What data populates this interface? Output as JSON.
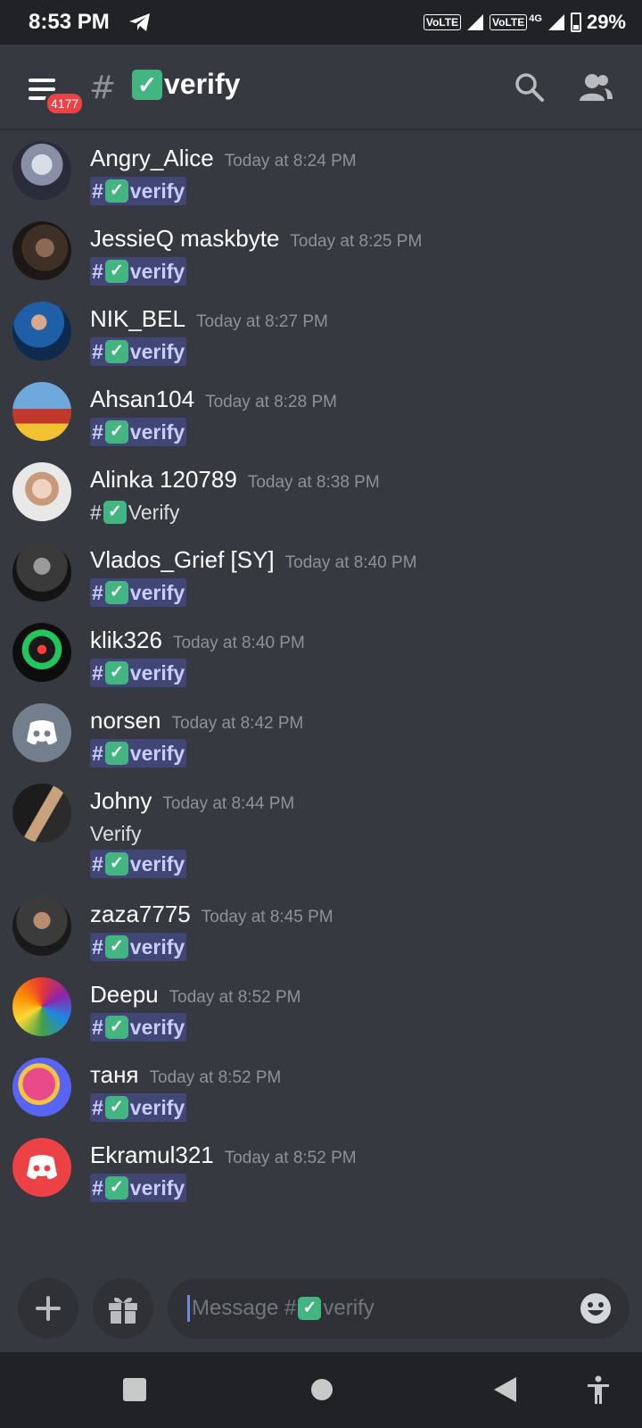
{
  "status_bar": {
    "time": "8:53 PM",
    "volte1": "VoLTE",
    "volte2": "VoLTE",
    "network": "4G",
    "battery": "29%"
  },
  "header": {
    "badge": "4177",
    "hash": "#",
    "channel_name": "verify"
  },
  "messages": [
    {
      "username": "Angry_Alice",
      "timestamp": "Today at 8:24 PM",
      "lines": [
        {
          "type": "mention",
          "text": "verify"
        }
      ]
    },
    {
      "username": "JessieQ maskbyte",
      "timestamp": "Today at 8:25 PM",
      "lines": [
        {
          "type": "mention",
          "text": "verify"
        }
      ]
    },
    {
      "username": "NIK_BEL",
      "timestamp": "Today at 8:27 PM",
      "lines": [
        {
          "type": "mention",
          "text": "verify"
        }
      ]
    },
    {
      "username": "Ahsan104",
      "timestamp": "Today at 8:28 PM",
      "lines": [
        {
          "type": "mention",
          "text": "verify"
        }
      ]
    },
    {
      "username": "Alinka 120789",
      "timestamp": "Today at 8:38 PM",
      "lines": [
        {
          "type": "plain_check",
          "text": "Verify"
        }
      ]
    },
    {
      "username": "Vlados_Grief [SY]",
      "timestamp": "Today at 8:40 PM",
      "lines": [
        {
          "type": "mention",
          "text": "verify"
        }
      ]
    },
    {
      "username": "klik326",
      "timestamp": "Today at 8:40 PM",
      "lines": [
        {
          "type": "mention",
          "text": "verify"
        }
      ]
    },
    {
      "username": "norsen",
      "timestamp": "Today at 8:42 PM",
      "lines": [
        {
          "type": "mention",
          "text": "verify"
        }
      ]
    },
    {
      "username": "Johny",
      "timestamp": "Today at 8:44 PM",
      "lines": [
        {
          "type": "text",
          "text": "Verify"
        },
        {
          "type": "mention",
          "text": "verify"
        }
      ]
    },
    {
      "username": "zaza7775",
      "timestamp": "Today at 8:45 PM",
      "lines": [
        {
          "type": "mention",
          "text": "verify"
        }
      ]
    },
    {
      "username": "Deepu",
      "timestamp": "Today at 8:52 PM",
      "lines": [
        {
          "type": "mention",
          "text": "verify"
        }
      ]
    },
    {
      "username": "таня",
      "timestamp": "Today at 8:52 PM",
      "lines": [
        {
          "type": "mention",
          "text": "verify"
        }
      ]
    },
    {
      "username": "Ekramul321",
      "timestamp": "Today at 8:52 PM",
      "lines": [
        {
          "type": "mention",
          "text": "verify"
        }
      ]
    }
  ],
  "input": {
    "placeholder_prefix": "Message #",
    "placeholder_channel": "verify"
  },
  "colors": {
    "background": "#36393f",
    "mention_bg": "#414675",
    "mention_text": "#c9cdfb",
    "check_green": "#43b581",
    "badge_red": "#ed4245",
    "discord_grey": "#747f8d",
    "discord_red": "#ed4245"
  }
}
